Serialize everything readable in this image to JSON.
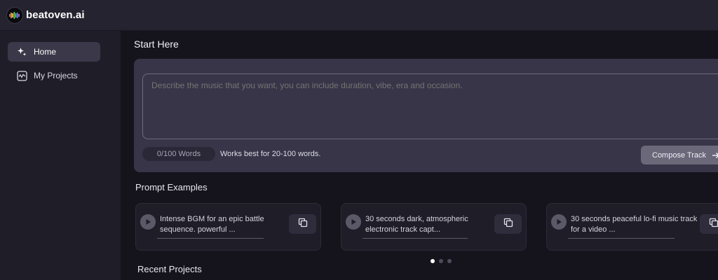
{
  "app": {
    "name": "beatoven.ai",
    "accent": "#373547"
  },
  "sidebar": {
    "items": [
      {
        "label": "Home",
        "icon": "sparkle-icon",
        "active": true
      },
      {
        "label": "My Projects",
        "icon": "waveform-icon",
        "active": false
      }
    ]
  },
  "main": {
    "start_title": "Start Here",
    "prompt_placeholder": "Describe the music that you want, you can include duration, vibe, era and occasion.",
    "word_count": "0/100 Words",
    "hint": "Works best for 20-100 words.",
    "compose_label": "Compose Track",
    "examples_title": "Prompt Examples",
    "examples": [
      {
        "line1": "Intense BGM for an epic battle",
        "line2": "sequence. powerful ..."
      },
      {
        "line1": "30 seconds dark, atmospheric",
        "line2": "electronic track capt..."
      },
      {
        "line1": "30 seconds peaceful lo-fi music track",
        "line2": "for a video ..."
      }
    ],
    "carousel_pages": 3,
    "carousel_active": 1,
    "recent_title": "Recent Projects"
  }
}
